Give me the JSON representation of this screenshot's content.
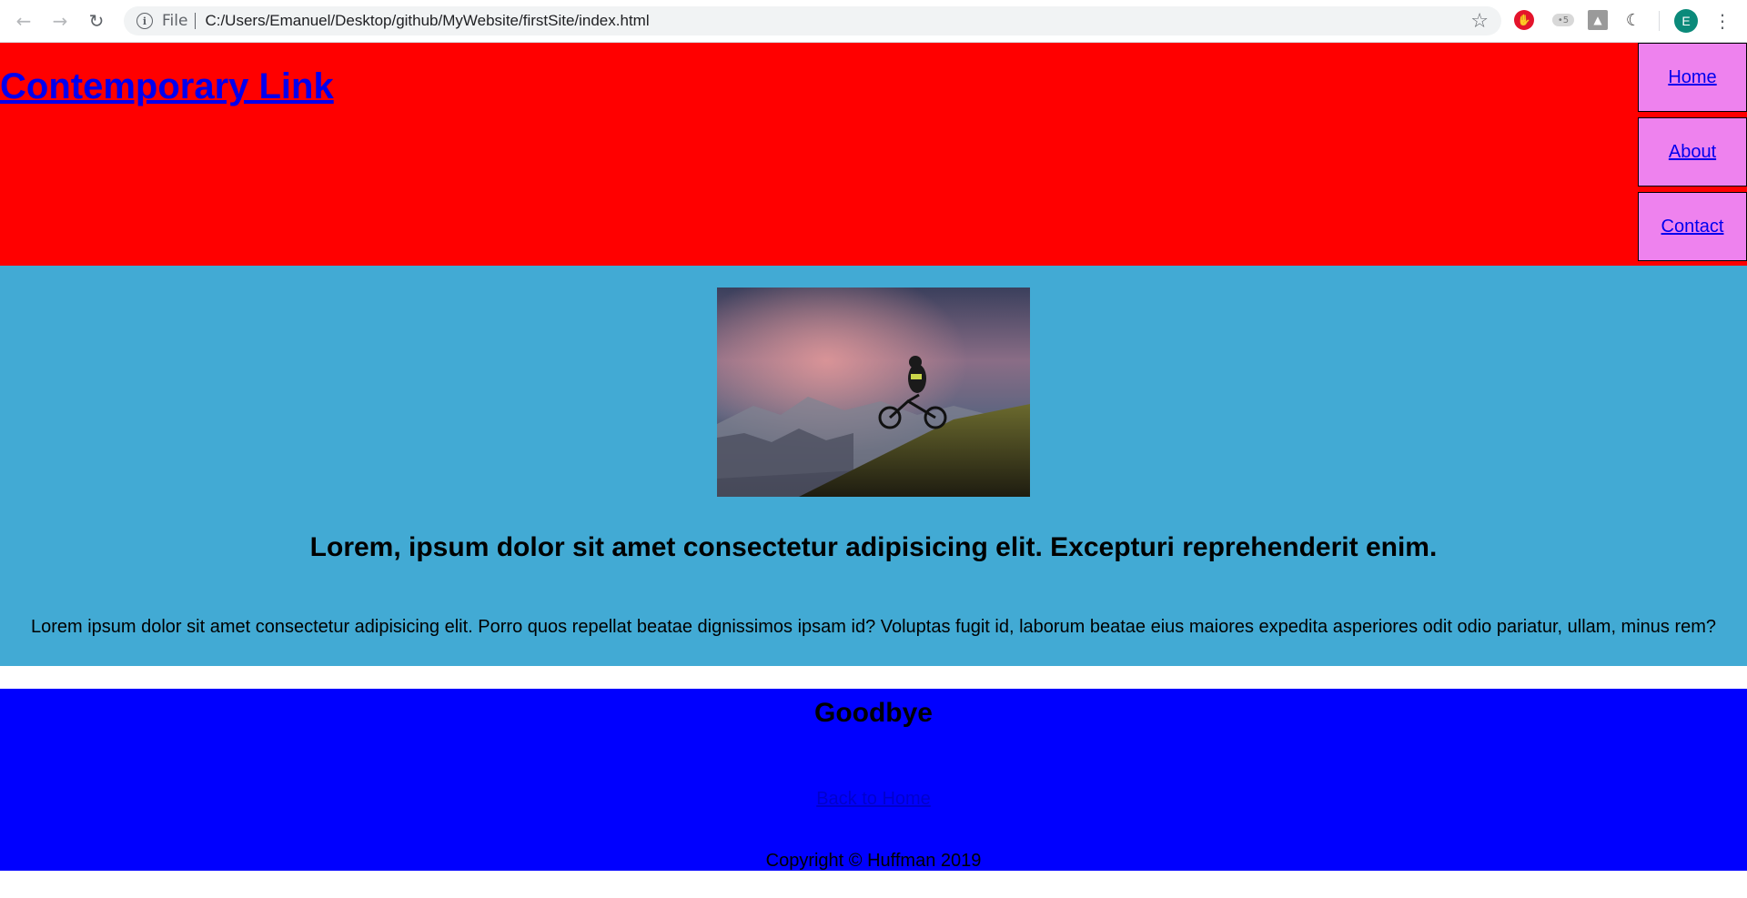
{
  "browser": {
    "back_icon": "arrow-left-icon",
    "forward_icon": "arrow-right-icon",
    "reload_icon": "reload-icon",
    "scheme_label": "File",
    "url": "C:/Users/Emanuel/Desktop/github/MyWebsite/firstSite/index.html",
    "profile_initial": "E"
  },
  "header": {
    "title": "Contemporary Link",
    "background": "#ff0000",
    "nav": [
      {
        "label": "Home"
      },
      {
        "label": "About"
      },
      {
        "label": "Contact"
      }
    ],
    "nav_background": "#ee82ee"
  },
  "main": {
    "background": "#42aad4",
    "image_description_icon": "mountain-biker-image",
    "heading": "Lorem, ipsum dolor sit amet consectetur adipisicing elit. Excepturi reprehenderit enim.",
    "paragraph": "Lorem ipsum dolor sit amet consectetur adipisicing elit. Porro quos repellat beatae dignissimos ipsam id? Voluptas fugit id, laborum beatae eius maiores expedita asperiores odit odio pariatur, ullam, minus rem?"
  },
  "footer": {
    "background": "#0000ff",
    "heading": "Goodbye",
    "link": "Back to Home",
    "copyright": "Copyright © Huffman 2019"
  }
}
